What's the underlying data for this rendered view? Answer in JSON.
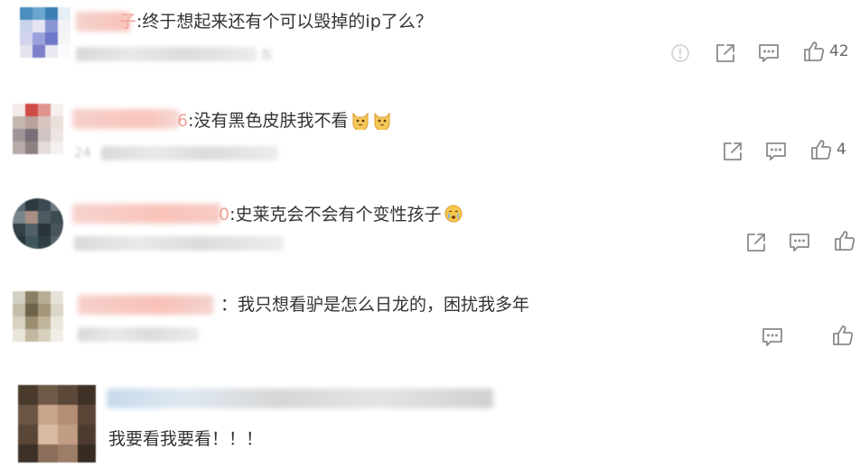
{
  "colors": {
    "text": "#333333",
    "icon": "#8a8a8a",
    "blur_pink": "#f7c9c3",
    "blur_grey": "#dddddd"
  },
  "comments": [
    {
      "name_visible": "子",
      "text": ":终于想起来还有个可以毁掉的ip了么？",
      "meta_visible": "东",
      "like_count": "42",
      "actions": [
        "report-icon",
        "share-icon",
        "comment-icon",
        "like-icon"
      ]
    },
    {
      "name_visible": "6",
      "text": ":没有黑色皮肤我不看",
      "emojis": [
        "cat-face-emoji",
        "cat-face-emoji"
      ],
      "meta_visible": "24",
      "like_count": "4",
      "actions": [
        "share-icon",
        "comment-icon",
        "like-icon"
      ]
    },
    {
      "name_visible": "0",
      "text": ":史莱克会不会有个变性孩子",
      "emojis": [
        "crying-face-emoji"
      ],
      "actions": [
        "share-icon",
        "comment-icon",
        "like-icon"
      ]
    },
    {
      "name_visible": "",
      "text": "：我只想看驴是怎么日龙的，困扰我多年",
      "actions": [
        "comment-icon",
        "like-icon"
      ]
    },
    {
      "name_visible": "",
      "text": "我要看我要看！！！",
      "actions": []
    }
  ]
}
